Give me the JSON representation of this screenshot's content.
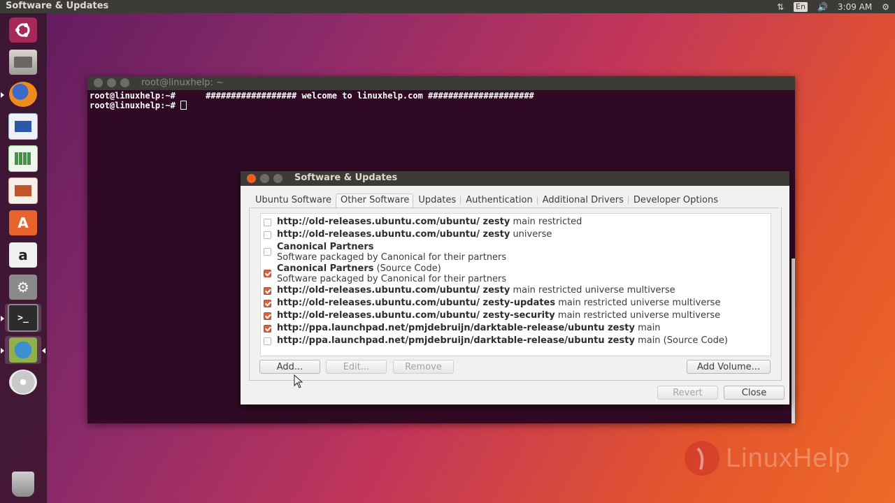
{
  "top_panel": {
    "title": "Software & Updates",
    "kbd_layout": "En",
    "time": "3:09 AM",
    "icons": [
      "network-icon",
      "volume-icon",
      "gear-icon"
    ]
  },
  "launcher": {
    "items": [
      "ubuntu-logo-icon",
      "files-icon",
      "firefox-icon",
      "writer-icon",
      "calc-icon",
      "impress-icon",
      "software-center-icon",
      "amazon-icon",
      "system-settings-icon",
      "terminal-icon",
      "software-updates-icon",
      "dvd-icon",
      "trash-icon"
    ]
  },
  "terminal": {
    "title": "root@linuxhelp: ~",
    "line1_prompt": "root@linuxhelp:~#",
    "line1_cmd": "      ################## welcome to linuxhelp.com #####################",
    "line2_prompt": "root@linuxhelp:~#"
  },
  "dialog": {
    "title": "Software & Updates",
    "tabs": [
      {
        "label": "Ubuntu Software",
        "active": false
      },
      {
        "label": "Other Software",
        "active": true
      },
      {
        "label": "Updates",
        "active": false
      },
      {
        "label": "Authentication",
        "active": false
      },
      {
        "label": "Additional Drivers",
        "active": false
      },
      {
        "label": "Developer Options",
        "active": false
      }
    ],
    "sources": [
      {
        "checked": false,
        "bold": "http://old-releases.ubuntu.com/ubuntu/ zesty",
        "rest": " main restricted",
        "sub": ""
      },
      {
        "checked": false,
        "bold": "http://old-releases.ubuntu.com/ubuntu/ zesty",
        "rest": " universe",
        "sub": ""
      },
      {
        "checked": false,
        "bold": "Canonical Partners",
        "rest": "",
        "sub": "Software packaged by Canonical for their partners"
      },
      {
        "checked": true,
        "bold": "Canonical Partners",
        "rest": " (Source Code)",
        "sub": "Software packaged by Canonical for their partners"
      },
      {
        "checked": true,
        "bold": "http://old-releases.ubuntu.com/ubuntu/ zesty",
        "rest": " main restricted universe multiverse",
        "sub": ""
      },
      {
        "checked": true,
        "bold": "http://old-releases.ubuntu.com/ubuntu/ zesty-updates",
        "rest": " main restricted universe multiverse",
        "sub": ""
      },
      {
        "checked": true,
        "bold": "http://old-releases.ubuntu.com/ubuntu/ zesty-security",
        "rest": " main restricted universe multiverse",
        "sub": ""
      },
      {
        "checked": true,
        "bold": "http://ppa.launchpad.net/pmjdebruijn/darktable-release/ubuntu zesty",
        "rest": " main",
        "sub": ""
      },
      {
        "checked": false,
        "bold": "http://ppa.launchpad.net/pmjdebruijn/darktable-release/ubuntu zesty",
        "rest": " main (Source Code)",
        "sub": ""
      }
    ],
    "buttons": {
      "add": "Add...",
      "edit": "Edit...",
      "remove": "Remove",
      "add_volume": "Add Volume...",
      "revert": "Revert",
      "close": "Close"
    }
  },
  "watermark": {
    "text": "LinuxHelp"
  },
  "colors": {
    "accent": "#e05f3b",
    "terminal_bg": "#300a24",
    "panel_bg": "#3c3b37"
  }
}
